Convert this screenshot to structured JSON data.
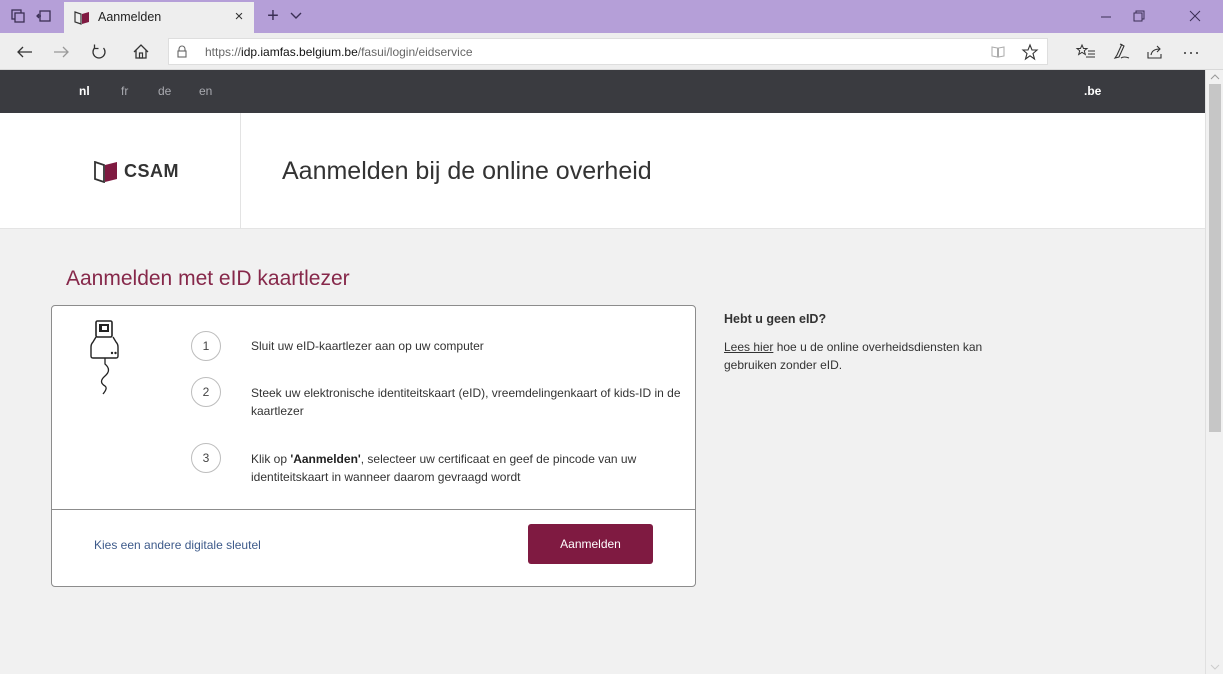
{
  "browser": {
    "tab_title": "Aanmelden",
    "tab_close": "×",
    "new_tab": "+",
    "tab_list": "⌵",
    "url_prefix": "https://",
    "url_host": "idp.iamfas.belgium.be",
    "url_path": "/fasui/login/eidservice",
    "icons": {
      "back": "back-arrow-icon",
      "forward": "forward-arrow-icon",
      "refresh": "refresh-icon",
      "home": "home-icon",
      "lock": "lock-icon",
      "reading_view": "reading-view-icon",
      "favorite": "star-icon",
      "favorites_hub": "favorites-list-icon",
      "notes": "pen-icon",
      "share": "share-icon",
      "more": "more-icon"
    },
    "accent": "#b59fd8"
  },
  "langbar": {
    "languages": [
      "nl",
      "fr",
      "de",
      "en"
    ],
    "active": "nl",
    "brand": ".be"
  },
  "header": {
    "logo_text": "CSAM",
    "title": "Aanmelden bij de online overheid"
  },
  "main": {
    "section_title": "Aanmelden met eID kaartlezer",
    "steps": [
      {
        "number": "1",
        "text": "Sluit uw eID-kaartlezer aan op uw computer"
      },
      {
        "number": "2",
        "text": "Steek uw elektronische identiteitskaart (eID), vreemdelingenkaart of kids-ID in de kaartlezer"
      },
      {
        "number": "3",
        "text_before": "Klik op ",
        "text_strong": "'Aanmelden'",
        "text_after": ", selecteer uw certificaat en geef de pincode van uw identiteitskaart in wanneer daarom gevraagd wordt"
      }
    ],
    "alt_link": "Kies een andere digitale sleutel",
    "login_button": "Aanmelden"
  },
  "sidebar": {
    "title": "Hebt u geen eID?",
    "link": "Lees hier",
    "text": " hoe u de online overheidsdiensten kan gebruiken zonder eID."
  },
  "colors": {
    "primary": "#7f1a41",
    "section_title": "#86284a",
    "langbar": "#3a3b40",
    "link": "#3d5a8a"
  }
}
